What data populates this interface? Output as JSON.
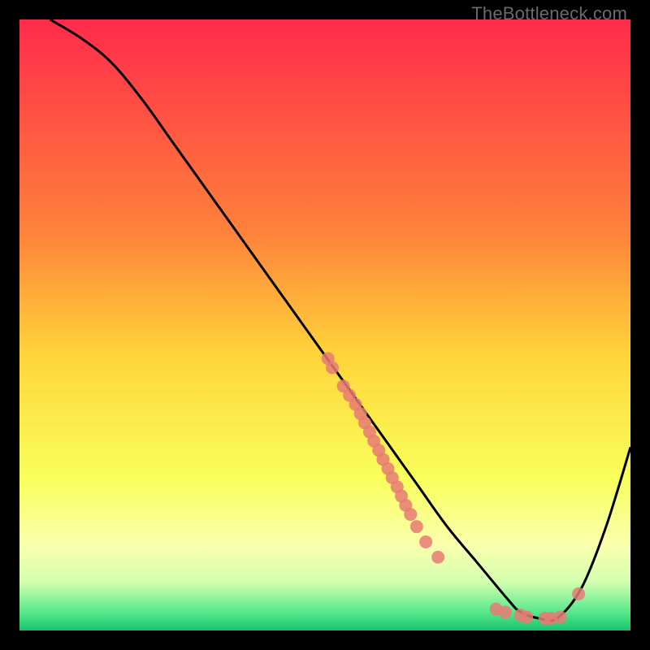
{
  "watermark": "TheBottleneck.com",
  "chart_data": {
    "type": "line",
    "title": "",
    "xlabel": "",
    "ylabel": "",
    "xlim": [
      0,
      100
    ],
    "ylim": [
      0,
      100
    ],
    "gradient_stops": [
      {
        "offset": 0,
        "color": "#ff2b4b"
      },
      {
        "offset": 35,
        "color": "#ff823a"
      },
      {
        "offset": 55,
        "color": "#ffd53a"
      },
      {
        "offset": 75,
        "color": "#f8ff5a"
      },
      {
        "offset": 86,
        "color": "#faffad"
      },
      {
        "offset": 92,
        "color": "#d4ffb0"
      },
      {
        "offset": 97,
        "color": "#57e88c"
      },
      {
        "offset": 100,
        "color": "#17c36c"
      }
    ],
    "series": [
      {
        "name": "bottleneck-curve",
        "x": [
          5,
          10,
          15,
          20,
          25,
          30,
          35,
          40,
          45,
          50,
          55,
          60,
          65,
          70,
          75,
          80,
          82,
          85,
          88,
          92,
          96,
          100
        ],
        "y": [
          100,
          97,
          93,
          87,
          80,
          73,
          66,
          59,
          52,
          45,
          38,
          31,
          24,
          17,
          11,
          5,
          3,
          2,
          2,
          7,
          17,
          30
        ]
      }
    ],
    "scatter": {
      "name": "sample-points",
      "color": "#e77a74",
      "points": [
        {
          "x": 50.5,
          "y": 44.5
        },
        {
          "x": 51.2,
          "y": 43.0
        },
        {
          "x": 53.0,
          "y": 40.0
        },
        {
          "x": 54.0,
          "y": 38.5
        },
        {
          "x": 55.0,
          "y": 37.0
        },
        {
          "x": 55.8,
          "y": 35.5
        },
        {
          "x": 56.5,
          "y": 34.0
        },
        {
          "x": 57.3,
          "y": 32.5
        },
        {
          "x": 58.0,
          "y": 31.0
        },
        {
          "x": 58.8,
          "y": 29.5
        },
        {
          "x": 59.5,
          "y": 28.0
        },
        {
          "x": 60.3,
          "y": 26.5
        },
        {
          "x": 61.0,
          "y": 25.0
        },
        {
          "x": 61.8,
          "y": 23.5
        },
        {
          "x": 62.5,
          "y": 22.0
        },
        {
          "x": 63.2,
          "y": 20.5
        },
        {
          "x": 64.0,
          "y": 19.0
        },
        {
          "x": 65.0,
          "y": 17.0
        },
        {
          "x": 66.5,
          "y": 14.5
        },
        {
          "x": 68.5,
          "y": 12.0
        },
        {
          "x": 78.0,
          "y": 3.5
        },
        {
          "x": 79.5,
          "y": 3.0
        },
        {
          "x": 82.0,
          "y": 2.5
        },
        {
          "x": 83.0,
          "y": 2.2
        },
        {
          "x": 86.0,
          "y": 2.0
        },
        {
          "x": 87.0,
          "y": 2.0
        },
        {
          "x": 88.5,
          "y": 2.2
        },
        {
          "x": 91.5,
          "y": 6.0
        }
      ]
    }
  }
}
